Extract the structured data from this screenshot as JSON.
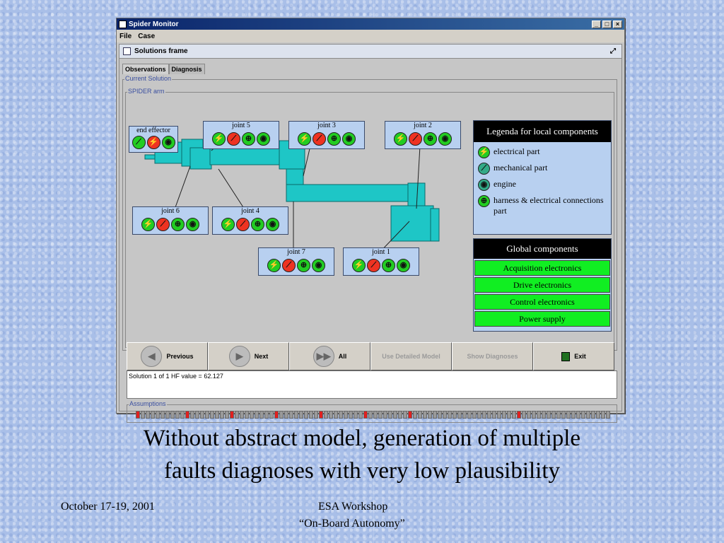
{
  "window": {
    "title": "Spider Monitor",
    "controls": [
      "_",
      "□",
      "×"
    ]
  },
  "menu": [
    "File",
    "Case"
  ],
  "frame": {
    "title": "Solutions frame"
  },
  "tabs": [
    {
      "label": "Observations"
    },
    {
      "label": "Diagnosis"
    }
  ],
  "groups": {
    "current": "Current Solution",
    "arm": "SPIDER arm",
    "assumptions": "Assumptions"
  },
  "components": [
    {
      "name": "end effector",
      "icons": [
        "mechanical",
        "electrical",
        "engine"
      ],
      "states": [
        "green",
        "red",
        "green"
      ]
    },
    {
      "name": "joint 5",
      "icons": [
        "electrical",
        "mechanical",
        "harness",
        "engine"
      ],
      "states": [
        "green",
        "red",
        "green",
        "green"
      ]
    },
    {
      "name": "joint 3",
      "icons": [
        "electrical",
        "mechanical",
        "harness",
        "engine"
      ],
      "states": [
        "green",
        "red",
        "green",
        "green"
      ]
    },
    {
      "name": "joint 2",
      "icons": [
        "electrical",
        "mechanical",
        "harness",
        "engine"
      ],
      "states": [
        "green",
        "red",
        "green",
        "green"
      ]
    },
    {
      "name": "joint 6",
      "icons": [
        "electrical",
        "mechanical",
        "harness",
        "engine"
      ],
      "states": [
        "green",
        "red",
        "green",
        "green"
      ]
    },
    {
      "name": "joint 4",
      "icons": [
        "electrical",
        "mechanical",
        "harness",
        "engine"
      ],
      "states": [
        "green",
        "red",
        "green",
        "green"
      ]
    },
    {
      "name": "joint 7",
      "icons": [
        "electrical",
        "mechanical",
        "harness",
        "engine"
      ],
      "states": [
        "green",
        "red",
        "green",
        "green"
      ]
    },
    {
      "name": "joint 1",
      "icons": [
        "electrical",
        "mechanical",
        "harness",
        "engine"
      ],
      "states": [
        "green",
        "red",
        "green",
        "green"
      ]
    }
  ],
  "legend": {
    "title": "Legenda for local components",
    "items": [
      {
        "icon": "electrical",
        "label": "electrical part"
      },
      {
        "icon": "mechanical",
        "label": "mechanical part"
      },
      {
        "icon": "engine",
        "label": "engine"
      },
      {
        "icon": "harness",
        "label": "harness & electrical connections part"
      }
    ]
  },
  "global": {
    "title": "Global components",
    "items": [
      "Acquisition electronics",
      "Drive electronics",
      "Control electronics",
      "Power supply"
    ]
  },
  "buttons": [
    {
      "label": "Previous"
    },
    {
      "label": "Next"
    },
    {
      "label": "All"
    },
    {
      "label": "Use Detailed Model"
    },
    {
      "label": "Show Diagnoses"
    },
    {
      "label": "Exit"
    }
  ],
  "status": "Solution 1 of 1 HF value = 62.127",
  "assumption_flags": [
    1,
    0,
    0,
    0,
    0,
    0,
    0,
    0,
    0,
    0,
    1,
    0,
    0,
    0,
    0,
    0,
    0,
    0,
    0,
    1,
    0,
    0,
    0,
    0,
    0,
    0,
    0,
    0,
    1,
    0,
    0,
    0,
    0,
    0,
    0,
    0,
    0,
    1,
    0,
    0,
    0,
    0,
    0,
    0,
    0,
    0,
    1,
    0,
    0,
    0,
    0,
    0,
    0,
    0,
    0,
    1,
    0,
    0,
    0,
    0,
    0,
    0,
    0,
    0,
    0,
    0,
    0,
    0,
    0,
    0,
    0,
    0,
    0,
    0,
    0,
    0,
    0,
    1,
    0,
    0,
    0,
    0,
    0,
    0,
    0,
    0,
    0,
    0,
    0,
    0,
    0,
    0,
    0,
    0,
    0,
    0
  ],
  "slide": {
    "caption_line1": "Without abstract model, generation of multiple",
    "caption_line2": "faults diagnoses with very low plausibility",
    "date": "October 17-19, 2001",
    "event_line1": "ESA Workshop",
    "event_line2": "“On-Board Autonomy”"
  },
  "colors": {
    "ok": "#22cc22",
    "fault": "#ee3322",
    "arm": "#1ec6c6",
    "global": "#11ee22"
  }
}
